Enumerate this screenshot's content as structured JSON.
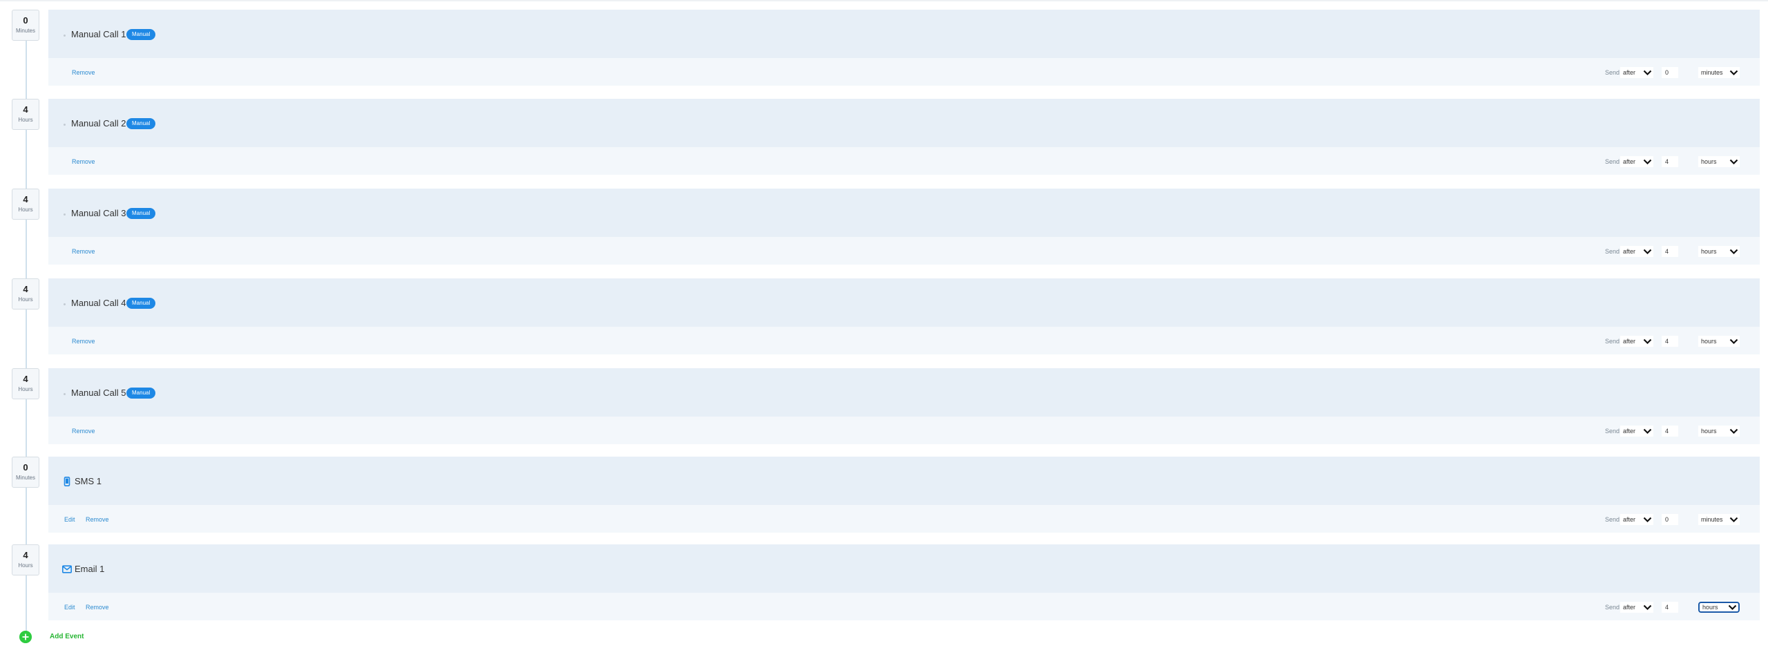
{
  "colors": {
    "accent": "#1e88e5",
    "link": "#2d8bd0",
    "add": "#2ecc40",
    "card_head": "#e7eff7",
    "card_body": "#f3f7fb"
  },
  "send_label": "Send",
  "remove_label": "Remove",
  "edit_label": "Edit",
  "add_event_label": "Add Event",
  "events": [
    {
      "title": "Manual Call 1",
      "tag": "Manual",
      "icon": "dot-icon",
      "delay_value": "0",
      "delay_unit": "Minutes",
      "timing": "after",
      "amount": "0",
      "unit": "minutes"
    },
    {
      "title": "Manual Call 2",
      "tag": "Manual",
      "icon": "dot-icon",
      "delay_value": "4",
      "delay_unit": "Hours",
      "timing": "after",
      "amount": "4",
      "unit": "hours"
    },
    {
      "title": "Manual Call 3",
      "tag": "Manual",
      "icon": "dot-icon",
      "delay_value": "4",
      "delay_unit": "Hours",
      "timing": "after",
      "amount": "4",
      "unit": "hours"
    },
    {
      "title": "Manual Call 4",
      "tag": "Manual",
      "icon": "dot-icon",
      "delay_value": "4",
      "delay_unit": "Hours",
      "timing": "after",
      "amount": "4",
      "unit": "hours"
    },
    {
      "title": "Manual Call 5",
      "tag": "Manual",
      "icon": "dot-icon",
      "delay_value": "4",
      "delay_unit": "Hours",
      "timing": "after",
      "amount": "4",
      "unit": "hours"
    },
    {
      "title": "SMS 1",
      "tag": "",
      "icon": "phone-icon",
      "delay_value": "0",
      "delay_unit": "Minutes",
      "timing": "after",
      "amount": "0",
      "unit": "minutes"
    },
    {
      "title": "Email 1",
      "tag": "",
      "icon": "envelope-icon",
      "delay_value": "4",
      "delay_unit": "Hours",
      "timing": "after",
      "amount": "4",
      "unit": "hours"
    }
  ]
}
